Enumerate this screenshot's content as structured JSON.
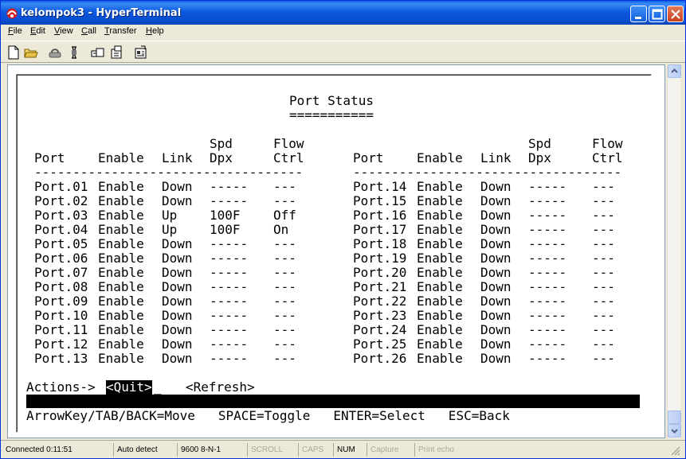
{
  "window": {
    "title": "kelompok3 - HyperTerminal"
  },
  "menu": [
    {
      "label": "File",
      "ul": "F",
      "rest": "ile"
    },
    {
      "label": "Edit",
      "ul": "E",
      "rest": "dit"
    },
    {
      "label": "View",
      "ul": "V",
      "rest": "iew"
    },
    {
      "label": "Call",
      "ul": "C",
      "rest": "all"
    },
    {
      "label": "Transfer",
      "ul": "T",
      "rest": "ransfer"
    },
    {
      "label": "Help",
      "ul": "H",
      "rest": "elp"
    }
  ],
  "toolbar": {
    "icons": [
      "new-icon",
      "open-icon",
      "connect-icon",
      "disconnect-icon",
      "send-icon",
      "receive-icon",
      "properties-icon"
    ]
  },
  "terminal": {
    "heading": "Port Status",
    "underline": "===========",
    "headers": {
      "port": "Port",
      "enable": "Enable",
      "link": "Link",
      "spd1": "Spd",
      "spd2": "Dpx",
      "flow1": "Flow",
      "flow2": "Ctrl"
    },
    "divider": "-----------------------------------",
    "left_rows": [
      [
        "Port.01",
        "Enable",
        "Down",
        "-----",
        "---"
      ],
      [
        "Port.02",
        "Enable",
        "Down",
        "-----",
        "---"
      ],
      [
        "Port.03",
        "Enable",
        "Up",
        "100F",
        "Off"
      ],
      [
        "Port.04",
        "Enable",
        "Up",
        "100F",
        "On"
      ],
      [
        "Port.05",
        "Enable",
        "Down",
        "-----",
        "---"
      ],
      [
        "Port.06",
        "Enable",
        "Down",
        "-----",
        "---"
      ],
      [
        "Port.07",
        "Enable",
        "Down",
        "-----",
        "---"
      ],
      [
        "Port.08",
        "Enable",
        "Down",
        "-----",
        "---"
      ],
      [
        "Port.09",
        "Enable",
        "Down",
        "-----",
        "---"
      ],
      [
        "Port.10",
        "Enable",
        "Down",
        "-----",
        "---"
      ],
      [
        "Port.11",
        "Enable",
        "Down",
        "-----",
        "---"
      ],
      [
        "Port.12",
        "Enable",
        "Down",
        "-----",
        "---"
      ],
      [
        "Port.13",
        "Enable",
        "Down",
        "-----",
        "---"
      ]
    ],
    "right_rows": [
      [
        "Port.14",
        "Enable",
        "Down",
        "-----",
        "---"
      ],
      [
        "Port.15",
        "Enable",
        "Down",
        "-----",
        "---"
      ],
      [
        "Port.16",
        "Enable",
        "Down",
        "-----",
        "---"
      ],
      [
        "Port.17",
        "Enable",
        "Down",
        "-----",
        "---"
      ],
      [
        "Port.18",
        "Enable",
        "Down",
        "-----",
        "---"
      ],
      [
        "Port.19",
        "Enable",
        "Down",
        "-----",
        "---"
      ],
      [
        "Port.20",
        "Enable",
        "Down",
        "-----",
        "---"
      ],
      [
        "Port.21",
        "Enable",
        "Down",
        "-----",
        "---"
      ],
      [
        "Port.22",
        "Enable",
        "Down",
        "-----",
        "---"
      ],
      [
        "Port.23",
        "Enable",
        "Down",
        "-----",
        "---"
      ],
      [
        "Port.24",
        "Enable",
        "Down",
        "-----",
        "---"
      ],
      [
        "Port.25",
        "Enable",
        "Down",
        "-----",
        "---"
      ],
      [
        "Port.26",
        "Enable",
        "Down",
        "-----",
        "---"
      ]
    ],
    "actions_label": "Actions->",
    "quit": "<Quit>",
    "refresh": "<Refresh>",
    "help_line": "ArrowKey/TAB/BACK=Move   SPACE=Toggle   ENTER=Select   ESC=Back"
  },
  "status": {
    "connected": "Connected 0:11:51",
    "detect": "Auto detect",
    "params": "9600 8-N-1",
    "scroll": "SCROLL",
    "caps": "CAPS",
    "num": "NUM",
    "capture": "Capture",
    "print_echo": "Print echo"
  }
}
